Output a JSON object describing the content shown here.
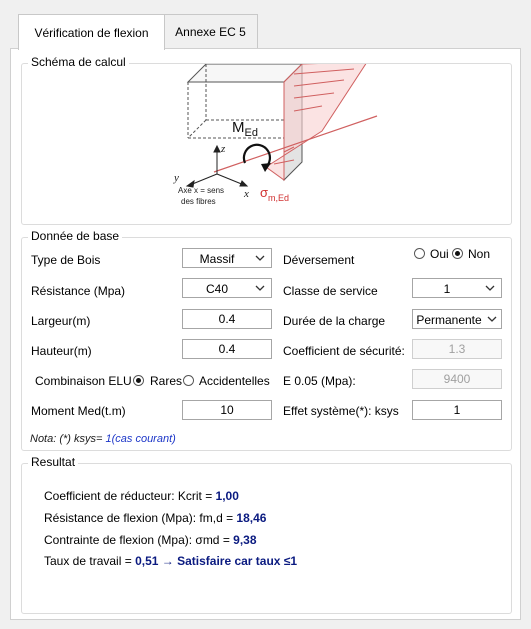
{
  "tabs": [
    {
      "label": "Vérification de flexion",
      "active": true
    },
    {
      "label": "Annexe EC 5",
      "active": false
    }
  ],
  "schema": {
    "legend": "Schéma de calcul",
    "moment_main": "M",
    "moment_sub": "Ed",
    "stress_main": "σ",
    "stress_sub": "m,Ed",
    "axis_z": "z",
    "axis_y": "y",
    "axis_x": "x",
    "axis_note_1": "Axe x = sens",
    "axis_note_2": "des fibres"
  },
  "base": {
    "legend": "Donnée de base",
    "type_bois_label": "Type de Bois",
    "type_bois_value": "Massif",
    "resistance_label": "Résistance (Mpa)",
    "resistance_value": "C40",
    "largeur_label": "Largeur(m)",
    "largeur_value": "0.4",
    "hauteur_label": "Hauteur(m)",
    "hauteur_value": "0.4",
    "combinaison_label": "Combinaison ELU",
    "rares_label": "Rares",
    "accidentelles_label": "Accidentelles",
    "moment_label": "Moment Med(t.m)",
    "moment_value": "10",
    "deversement_label": "Déversement",
    "oui_label": "Oui",
    "non_label": "Non",
    "classe_label": "Classe de service",
    "classe_value": "1",
    "duree_label": "Durée de la charge",
    "duree_value": "Permanente",
    "coef_label": "Coefficient de sécurité:",
    "coef_value": "1.3",
    "e005_label": "E 0.05 (Mpa):",
    "e005_value": "9400",
    "effet_label": "Effet système(*): ksys",
    "effet_value": "1",
    "note_prefix": "Nota: (*)  ksys=",
    "note_value": " 1(cas courant)"
  },
  "result": {
    "legend": "Resultat",
    "line1_label": "Coefficient de réducteur: Kcrit = ",
    "line1_value": "1,00",
    "line2_label": "Résistance de flexion (Mpa): fm,d = ",
    "line2_value": "18,46",
    "line3_label": "Contrainte de flexion (Mpa): σmd = ",
    "line3_value": "9,38",
    "line4_label": "Taux de travail = ",
    "line4_value": "0,51  →  Satisfaire car taux ≤1"
  }
}
